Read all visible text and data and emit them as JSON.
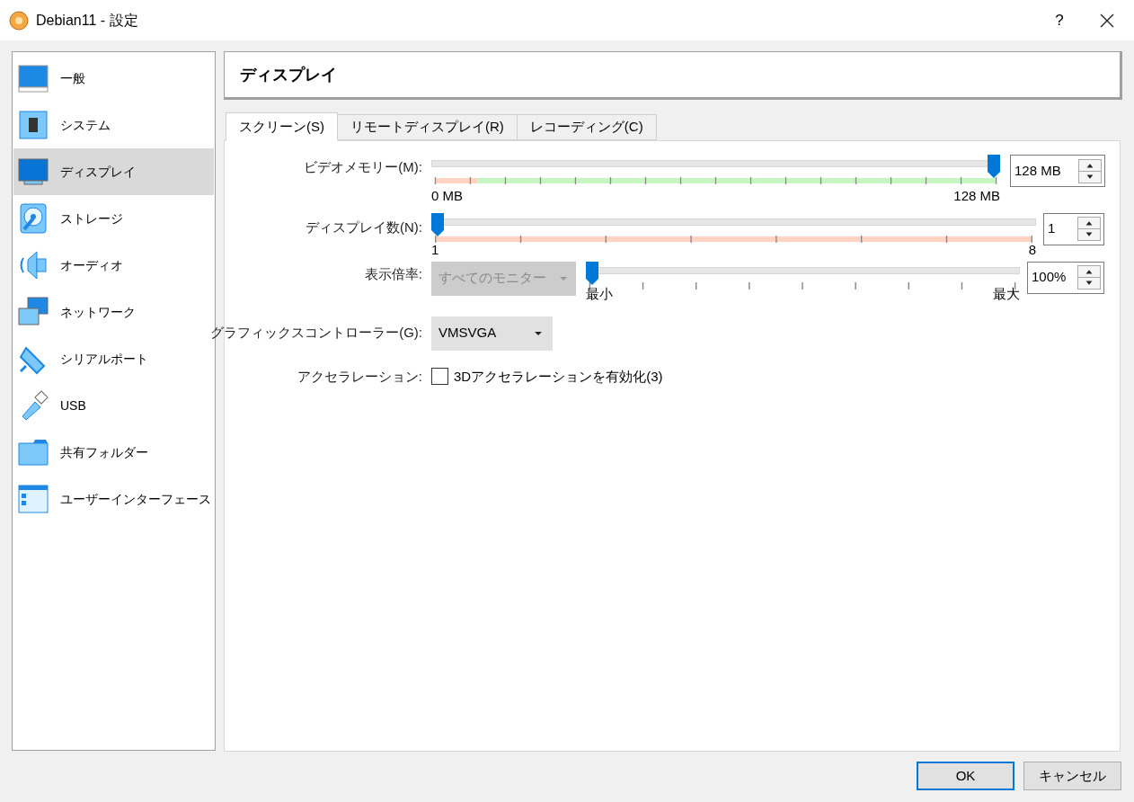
{
  "window": {
    "title": "Debian11 - 設定",
    "help": "?"
  },
  "sidebar": {
    "items": [
      {
        "label": "一般",
        "selected": false
      },
      {
        "label": "システム",
        "selected": false
      },
      {
        "label": "ディスプレイ",
        "selected": true
      },
      {
        "label": "ストレージ",
        "selected": false
      },
      {
        "label": "オーディオ",
        "selected": false
      },
      {
        "label": "ネットワーク",
        "selected": false
      },
      {
        "label": "シリアルポート",
        "selected": false
      },
      {
        "label": "USB",
        "selected": false
      },
      {
        "label": "共有フォルダー",
        "selected": false
      },
      {
        "label": "ユーザーインターフェース",
        "selected": false
      }
    ]
  },
  "page_title": "ディスプレイ",
  "tabs": [
    {
      "label": "スクリーン(S)",
      "selected": true
    },
    {
      "label": "リモートディスプレイ(R)",
      "selected": false
    },
    {
      "label": "レコーディング(C)",
      "selected": false
    }
  ],
  "video_memory": {
    "label": "ビデオメモリー(M):",
    "level": 1,
    "min_label": "0 MB",
    "max_label": "128 MB",
    "value": "128 MB"
  },
  "monitor_count": {
    "label": "ディスプレイ数(N):",
    "level": 0,
    "min_label": "1",
    "max_label": "8",
    "value": "1"
  },
  "scale_factor": {
    "label": "表示倍率:",
    "monitor_select": {
      "value": "すべてのモニター",
      "disabled": true
    },
    "level": 0,
    "min_label": "最小",
    "max_label": "最大",
    "value": "100%"
  },
  "graphics_controller": {
    "label": "グラフィックスコントローラー(G):",
    "value": "VMSVGA"
  },
  "acceleration": {
    "label": "アクセラレーション:",
    "checkbox": {
      "label": "3Dアクセラレーションを有効化(3)",
      "checked": false
    }
  },
  "buttons": [
    {
      "label": "OK",
      "default": true
    },
    {
      "label": "キャンセル",
      "default": false
    }
  ]
}
